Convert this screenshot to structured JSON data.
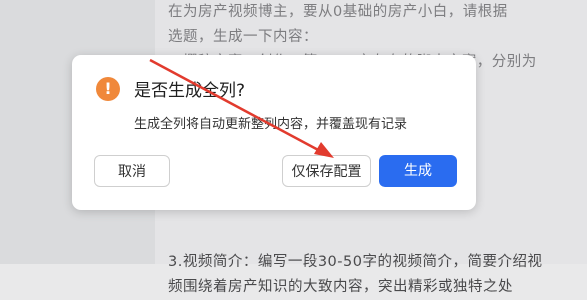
{
  "background": {
    "lines": [
      "在为房产视频博主，要从0基础的房产小白，请根据",
      "选题，生成一下内容：",
      "1.撰稿文案：创作一篇1000字左右的脚本文案，分别为",
      "",
      "",
      "",
      "",
      "",
      "",
      "",
      "3.视频简介：编写一段30-50字的视频简介，简要介绍视",
      "频围绕着房产知识的大致内容，突出精彩或独特之处"
    ]
  },
  "dialog": {
    "icon": "warning-icon",
    "title": "是否生成全列?",
    "message": "生成全列将自动更新整列内容，并覆盖现有记录",
    "cancel_label": "取消",
    "save_label": "仅保存配置",
    "generate_label": "生成"
  },
  "colors": {
    "primary": "#2a6cf0",
    "warning": "#f0883a",
    "annotation_arrow": "#e23b2e"
  }
}
